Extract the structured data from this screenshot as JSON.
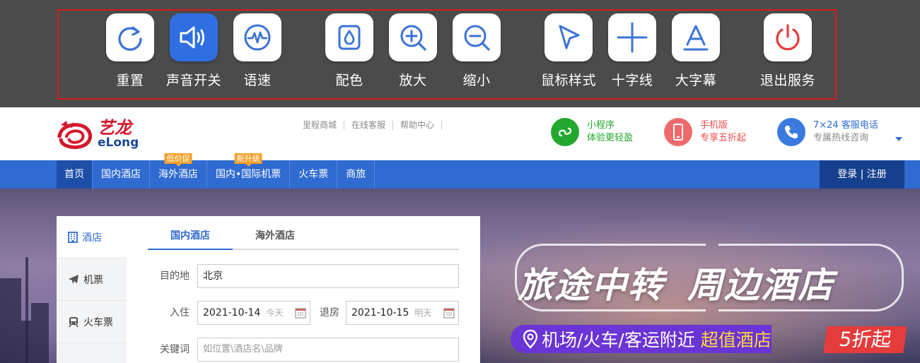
{
  "a11y_toolbar": {
    "tools": [
      {
        "label": "重置",
        "icon": "reset-icon",
        "active": false
      },
      {
        "label": "声音开关",
        "icon": "speaker-icon",
        "active": true
      },
      {
        "label": "语速",
        "icon": "speed-waveform-icon",
        "active": false
      },
      {
        "label": "配色",
        "icon": "color-drop-icon",
        "active": false
      },
      {
        "label": "放大",
        "icon": "zoom-in-icon",
        "active": false
      },
      {
        "label": "缩小",
        "icon": "zoom-out-icon",
        "active": false
      },
      {
        "label": "鼠标样式",
        "icon": "cursor-icon",
        "active": false
      },
      {
        "label": "十字线",
        "icon": "crosshair-icon",
        "active": false
      },
      {
        "label": "大字幕",
        "icon": "big-caption-icon",
        "active": false
      },
      {
        "label": "退出服务",
        "icon": "power-icon",
        "active": false
      }
    ],
    "colors": {
      "background": "#4b4b4b",
      "frame": "#d61c1c",
      "active": "#2f6fe2"
    }
  },
  "header": {
    "logo": {
      "cn": "艺龙",
      "en": "eLong"
    },
    "links": [
      "里程商城",
      "在线客服",
      "帮助中心"
    ],
    "promos": [
      {
        "line1": "小程序",
        "line2": "体验更轻盈",
        "icon": "mini-program-icon",
        "color": "#22a82e"
      },
      {
        "line1": "手机版",
        "line2": "专享五折起",
        "icon": "mobile-phone-icon",
        "color": "#ef4b4b"
      },
      {
        "line1": "7×24 客服电话",
        "line2": "专属热线咨询",
        "icon": "phone-icon",
        "color": "#2f6bd1"
      }
    ]
  },
  "nav": {
    "items": [
      {
        "label": "首页",
        "badge": ""
      },
      {
        "label": "国内酒店",
        "badge": ""
      },
      {
        "label": "海外酒店",
        "badge": "低价促"
      },
      {
        "label": "国内•国际机票",
        "badge": "新升级"
      },
      {
        "label": "火车票",
        "badge": ""
      },
      {
        "label": "商旅",
        "badge": ""
      }
    ],
    "login": "登录 | 注册"
  },
  "search": {
    "side_tabs": [
      {
        "label": "酒店",
        "icon": "hotel-icon"
      },
      {
        "label": "机票",
        "icon": "plane-icon"
      },
      {
        "label": "火车票",
        "icon": "train-icon"
      }
    ],
    "hotel_tabs": [
      "国内酒店",
      "海外酒店"
    ],
    "destination": {
      "label": "目的地",
      "value": "北京"
    },
    "checkin": {
      "label": "入住",
      "value": "2021-10-14",
      "hint": "今天"
    },
    "checkout": {
      "label": "退房",
      "value": "2021-10-15",
      "hint": "明天"
    },
    "keyword": {
      "label": "关键词",
      "placeholder": "如位置\\酒店名\\品牌"
    }
  },
  "banner": {
    "title_left": "旅途中转",
    "title_right": "周边酒店",
    "strip_main": "机场/火车/客运附近",
    "strip_highlight": "超值酒店",
    "discount": "5折起"
  }
}
